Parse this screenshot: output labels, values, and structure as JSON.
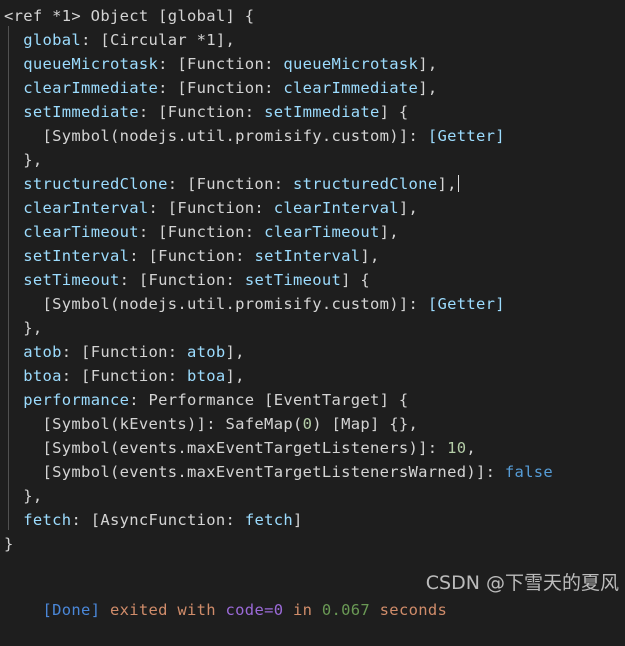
{
  "terminal": {
    "background_color": "#1e1e1e",
    "foreground_color": "#d4d4d4",
    "font_size_px": 15.5,
    "line_height_px": 24,
    "indent_guide_color": "#5a5a5a",
    "caret_color": "#dcdcdc"
  },
  "output": {
    "lines": [
      {
        "indent": 0,
        "tokens": [
          {
            "t": "<ref *1> Object [global] {",
            "c": "pl"
          }
        ]
      },
      {
        "indent": 1,
        "tokens": [
          {
            "t": "global",
            "c": "key"
          },
          {
            "t": ": [Circular *1],",
            "c": "pl"
          }
        ]
      },
      {
        "indent": 1,
        "tokens": [
          {
            "t": "queueMicrotask",
            "c": "key"
          },
          {
            "t": ": [Function: ",
            "c": "pl"
          },
          {
            "t": "queueMicrotask",
            "c": "fn"
          },
          {
            "t": "],",
            "c": "pl"
          }
        ]
      },
      {
        "indent": 1,
        "tokens": [
          {
            "t": "clearImmediate",
            "c": "key"
          },
          {
            "t": ": [Function: ",
            "c": "pl"
          },
          {
            "t": "clearImmediate",
            "c": "fn"
          },
          {
            "t": "],",
            "c": "pl"
          }
        ]
      },
      {
        "indent": 1,
        "tokens": [
          {
            "t": "setImmediate",
            "c": "key"
          },
          {
            "t": ": [Function: ",
            "c": "pl"
          },
          {
            "t": "setImmediate",
            "c": "fn"
          },
          {
            "t": "] {",
            "c": "pl"
          }
        ]
      },
      {
        "indent": 2,
        "tokens": [
          {
            "t": "[Symbol(nodejs.util.promisify.custom)]: ",
            "c": "pl"
          },
          {
            "t": "[Getter]",
            "c": "key"
          }
        ]
      },
      {
        "indent": 1,
        "tokens": [
          {
            "t": "},",
            "c": "pl"
          }
        ]
      },
      {
        "indent": 1,
        "caret": true,
        "tokens": [
          {
            "t": "structuredClone",
            "c": "key"
          },
          {
            "t": ": [Function: ",
            "c": "pl"
          },
          {
            "t": "structuredClone",
            "c": "fn"
          },
          {
            "t": "],",
            "c": "pl"
          }
        ]
      },
      {
        "indent": 1,
        "tokens": [
          {
            "t": "clearInterval",
            "c": "key"
          },
          {
            "t": ": [Function: ",
            "c": "pl"
          },
          {
            "t": "clearInterval",
            "c": "fn"
          },
          {
            "t": "],",
            "c": "pl"
          }
        ]
      },
      {
        "indent": 1,
        "tokens": [
          {
            "t": "clearTimeout",
            "c": "key"
          },
          {
            "t": ": [Function: ",
            "c": "pl"
          },
          {
            "t": "clearTimeout",
            "c": "fn"
          },
          {
            "t": "],",
            "c": "pl"
          }
        ]
      },
      {
        "indent": 1,
        "tokens": [
          {
            "t": "setInterval",
            "c": "key"
          },
          {
            "t": ": [Function: ",
            "c": "pl"
          },
          {
            "t": "setInterval",
            "c": "fn"
          },
          {
            "t": "],",
            "c": "pl"
          }
        ]
      },
      {
        "indent": 1,
        "tokens": [
          {
            "t": "setTimeout",
            "c": "key"
          },
          {
            "t": ": [Function: ",
            "c": "pl"
          },
          {
            "t": "setTimeout",
            "c": "fn"
          },
          {
            "t": "] {",
            "c": "pl"
          }
        ]
      },
      {
        "indent": 2,
        "tokens": [
          {
            "t": "[Symbol(nodejs.util.promisify.custom)]: ",
            "c": "pl"
          },
          {
            "t": "[Getter]",
            "c": "key"
          }
        ]
      },
      {
        "indent": 1,
        "tokens": [
          {
            "t": "},",
            "c": "pl"
          }
        ]
      },
      {
        "indent": 1,
        "tokens": [
          {
            "t": "atob",
            "c": "key"
          },
          {
            "t": ": [Function: ",
            "c": "pl"
          },
          {
            "t": "atob",
            "c": "fn"
          },
          {
            "t": "],",
            "c": "pl"
          }
        ]
      },
      {
        "indent": 1,
        "tokens": [
          {
            "t": "btoa",
            "c": "key"
          },
          {
            "t": ": [Function: ",
            "c": "pl"
          },
          {
            "t": "btoa",
            "c": "fn"
          },
          {
            "t": "],",
            "c": "pl"
          }
        ]
      },
      {
        "indent": 1,
        "tokens": [
          {
            "t": "performance",
            "c": "key"
          },
          {
            "t": ": Performance [EventTarget] {",
            "c": "pl"
          }
        ]
      },
      {
        "indent": 2,
        "tokens": [
          {
            "t": "[Symbol(kEvents)]: SafeMap(",
            "c": "pl"
          },
          {
            "t": "0",
            "c": "num"
          },
          {
            "t": ") [Map] {},",
            "c": "pl"
          }
        ]
      },
      {
        "indent": 2,
        "tokens": [
          {
            "t": "[Symbol(events.maxEventTargetListeners)]: ",
            "c": "pl"
          },
          {
            "t": "10",
            "c": "num"
          },
          {
            "t": ",",
            "c": "pl"
          }
        ]
      },
      {
        "indent": 2,
        "tokens": [
          {
            "t": "[Symbol(events.maxEventTargetListenersWarned)]: ",
            "c": "pl"
          },
          {
            "t": "false",
            "c": "bool"
          }
        ]
      },
      {
        "indent": 1,
        "tokens": [
          {
            "t": "},",
            "c": "pl"
          }
        ]
      },
      {
        "indent": 1,
        "tokens": [
          {
            "t": "fetch",
            "c": "key"
          },
          {
            "t": ": [AsyncFunction: ",
            "c": "pl"
          },
          {
            "t": "fetch",
            "c": "fn"
          },
          {
            "t": "]",
            "c": "pl"
          }
        ]
      },
      {
        "indent": 0,
        "tokens": [
          {
            "t": "}",
            "c": "pl"
          }
        ]
      },
      {
        "indent": 0,
        "tokens": [
          {
            "t": "",
            "c": "pl"
          }
        ]
      }
    ]
  },
  "status": {
    "done_label": "[Done]",
    "exited_with": " exited with ",
    "exit_code": "code=0",
    "in_label": " in ",
    "duration": "0.067",
    "seconds_label": " seconds",
    "done_color": "#4a87d8",
    "text_color": "#d08c6a",
    "code_color": "#9b6ad8",
    "duration_color": "#6a9955"
  },
  "watermark": {
    "text": "CSDN @下雪天的夏风",
    "color": "#c9c9c9"
  }
}
